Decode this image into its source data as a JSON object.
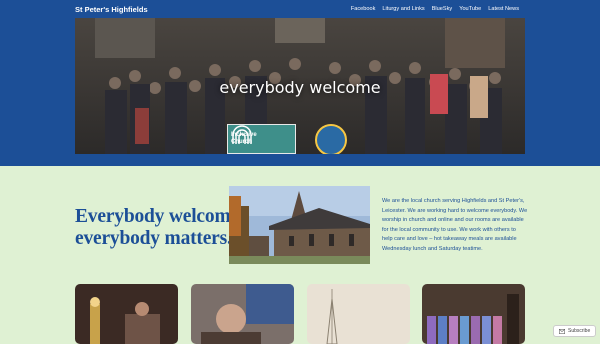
{
  "site": {
    "title": "St Peter's Highfields"
  },
  "nav": [
    "Facebook",
    "Liturgy and Links",
    "BlueSky",
    "YouTube",
    "Latest News"
  ],
  "hero": {
    "title": "everybody welcome",
    "badge_text_1": "Inclusive",
    "badge_text_2": "Church"
  },
  "intro": {
    "headline_1": "Everybody welcome,",
    "headline_2": "everybody matters.",
    "paragraph": "We are the local church serving Highfields and St Peter's, Leicester. We are working hard to welcome everybody. We worship in church and online and our rooms are available for the local community to use. We work with others to help care and love – hot takeaway meals are available Wednesday lunch and Saturday teatime."
  },
  "subscribe": {
    "label": "Subscribe"
  },
  "colors": {
    "header": "#1c4f97",
    "background": "#dff1d3",
    "accent_text": "#1c4f97"
  }
}
